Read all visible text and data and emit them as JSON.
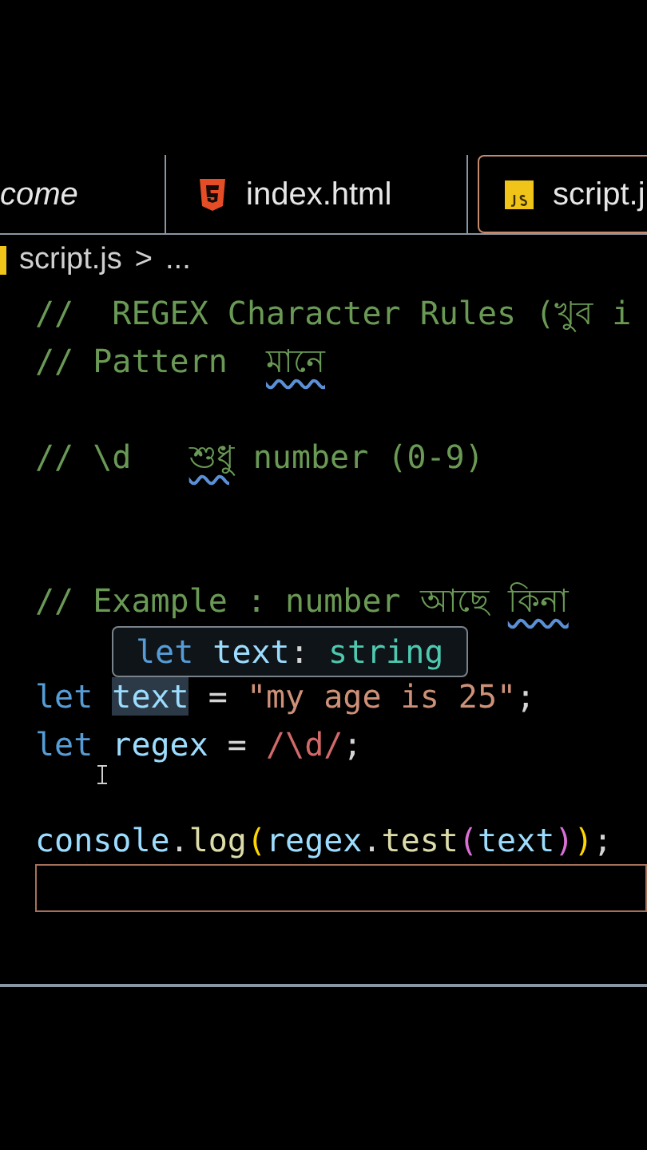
{
  "tabs": [
    {
      "label": "come",
      "kind": "plain",
      "selected": false
    },
    {
      "label": "index.html",
      "kind": "html",
      "selected": false
    },
    {
      "label": "script.j",
      "kind": "js",
      "selected": true
    }
  ],
  "breadcrumb": {
    "file": "script.js",
    "separator": ">",
    "rest": "..."
  },
  "code_lines": [
    {
      "kind": "code",
      "tokens": [
        {
          "text": "//  REGEX Character Rules (খুব i",
          "kind": "comment",
          "squiggle": false,
          "highlighted": false
        }
      ]
    },
    {
      "kind": "code",
      "tokens": [
        {
          "text": "// Pattern  ",
          "kind": "comment",
          "squiggle": false,
          "highlighted": false
        },
        {
          "text": "মানে",
          "kind": "comment",
          "squiggle": true,
          "highlighted": false
        }
      ]
    },
    {
      "kind": "blank",
      "current": false
    },
    {
      "kind": "code",
      "tokens": [
        {
          "text": "// \\d   ",
          "kind": "comment",
          "squiggle": false,
          "highlighted": false
        },
        {
          "text": "শুধু",
          "kind": "comment",
          "squiggle": true,
          "highlighted": false
        },
        {
          "text": " number (0-9)",
          "kind": "comment",
          "squiggle": false,
          "highlighted": false
        }
      ]
    },
    {
      "kind": "blank",
      "current": false
    },
    {
      "kind": "blank",
      "current": false
    },
    {
      "kind": "code",
      "tokens": [
        {
          "text": "// Example : number আছে ",
          "kind": "comment",
          "squiggle": false,
          "highlighted": false
        },
        {
          "text": "কিনা",
          "kind": "comment",
          "squiggle": true,
          "highlighted": false
        }
      ]
    },
    {
      "kind": "blank",
      "current": false
    },
    {
      "kind": "code",
      "tokens": [
        {
          "text": "let ",
          "kind": "keyword",
          "squiggle": false,
          "highlighted": false
        },
        {
          "text": "text",
          "kind": "variable",
          "squiggle": false,
          "highlighted": true
        },
        {
          "text": " = ",
          "kind": "punct",
          "squiggle": false,
          "highlighted": false
        },
        {
          "text": "\"my age is 25\"",
          "kind": "string",
          "squiggle": false,
          "highlighted": false
        },
        {
          "text": ";",
          "kind": "punct",
          "squiggle": false,
          "highlighted": false
        }
      ]
    },
    {
      "kind": "code",
      "tokens": [
        {
          "text": "let",
          "kind": "keyword",
          "squiggle": false,
          "highlighted": false
        },
        {
          "text": " regex",
          "kind": "variable",
          "squiggle": false,
          "highlighted": false
        },
        {
          "text": " = ",
          "kind": "punct",
          "squiggle": false,
          "highlighted": false
        },
        {
          "text": "/\\d/",
          "kind": "regex",
          "squiggle": false,
          "highlighted": false
        },
        {
          "text": ";",
          "kind": "punct",
          "squiggle": false,
          "highlighted": false
        }
      ]
    },
    {
      "kind": "blank",
      "current": false
    },
    {
      "kind": "code",
      "tokens": [
        {
          "text": "console",
          "kind": "variable",
          "squiggle": false,
          "highlighted": false
        },
        {
          "text": ".",
          "kind": "punct",
          "squiggle": false,
          "highlighted": false
        },
        {
          "text": "log",
          "kind": "function",
          "squiggle": false,
          "highlighted": false
        },
        {
          "text": "(",
          "kind": "paren1",
          "squiggle": false,
          "highlighted": false
        },
        {
          "text": "regex",
          "kind": "variable",
          "squiggle": false,
          "highlighted": false
        },
        {
          "text": ".",
          "kind": "punct",
          "squiggle": false,
          "highlighted": false
        },
        {
          "text": "test",
          "kind": "function",
          "squiggle": false,
          "highlighted": false
        },
        {
          "text": "(",
          "kind": "paren2",
          "squiggle": false,
          "highlighted": false
        },
        {
          "text": "text",
          "kind": "variable",
          "squiggle": false,
          "highlighted": false
        },
        {
          "text": ")",
          "kind": "paren2",
          "squiggle": false,
          "highlighted": false
        },
        {
          "text": ")",
          "kind": "paren1",
          "squiggle": false,
          "highlighted": false
        },
        {
          "text": ";",
          "kind": "punct",
          "squiggle": false,
          "highlighted": false
        }
      ]
    },
    {
      "kind": "blank",
      "current": true
    }
  ],
  "tooltip": {
    "keyword": "let",
    "name": "text",
    "separator": ":",
    "type": "string"
  }
}
